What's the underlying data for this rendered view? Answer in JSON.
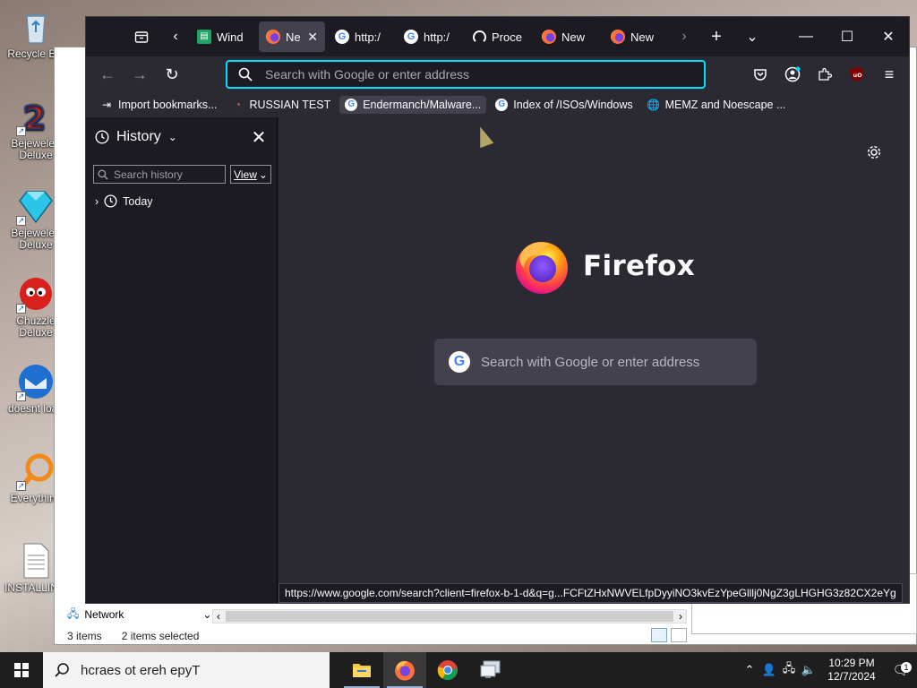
{
  "desktop": {
    "icons": [
      {
        "label": "Recycle Bin",
        "shortcut": false
      },
      {
        "label": "Bejeweled Deluxe",
        "shortcut": true
      },
      {
        "label": "Bejeweled Deluxe",
        "shortcut": true
      },
      {
        "label": "Chuzzle Deluxe",
        "shortcut": true
      },
      {
        "label": "doesnt load",
        "shortcut": true
      },
      {
        "label": "Everything",
        "shortcut": true
      },
      {
        "label": "INSTALLIN...",
        "shortcut": false
      }
    ]
  },
  "explorer": {
    "nav_item": "Network",
    "status_items": "3 items",
    "status_selected": "2 items selected"
  },
  "firefox": {
    "tabs": [
      {
        "label": "Wind",
        "icon": "sheet-icon",
        "active": false
      },
      {
        "label": "Ne",
        "icon": "firefox-icon",
        "active": true
      },
      {
        "label": "http:/",
        "icon": "google-icon",
        "active": false
      },
      {
        "label": "http:/",
        "icon": "google-icon",
        "active": false
      },
      {
        "label": "Proce",
        "icon": "gauge-icon",
        "active": false
      },
      {
        "label": "New",
        "icon": "firefox-icon",
        "active": false
      },
      {
        "label": "New",
        "icon": "firefox-icon",
        "active": false
      }
    ],
    "urlbar_placeholder": "Search with Google or enter address",
    "bookmarks": [
      {
        "label": "Import bookmarks...",
        "icon": "import-icon"
      },
      {
        "label": "RUSSIAN TEST",
        "icon": "magnifier-icon"
      },
      {
        "label": "Endermanch/Malware...",
        "icon": "google-icon"
      },
      {
        "label": "Index of /ISOs/Windows",
        "icon": "google-icon"
      },
      {
        "label": "MEMZ and Noescape ...",
        "icon": "globe-icon"
      }
    ],
    "sidebar": {
      "title": "History",
      "search_placeholder": "Search history",
      "view_label": "View",
      "tree_today": "Today"
    },
    "newtab": {
      "brand": "Firefox",
      "search_placeholder": "Search with Google or enter address"
    },
    "status_url": "https://www.google.com/search?client=firefox-b-1-d&q=g...FCFtZHxNWVELfpDyyiNO3kvEzYpeGlllj0NgZ3gLHGHG3z82CX2eYg"
  },
  "taskbar": {
    "search_placeholder": "hcraes ot ereh epyT",
    "time": "10:29 PM",
    "date": "12/7/2024",
    "notification_count": "1"
  }
}
